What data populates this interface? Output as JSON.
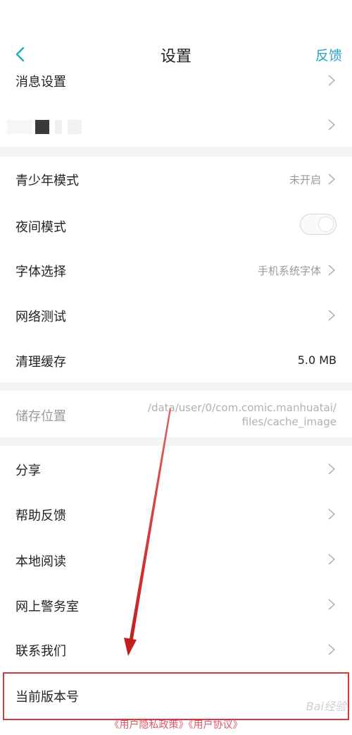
{
  "header": {
    "title": "设置",
    "feedback_label": "反馈"
  },
  "rows": {
    "message_settings": "消息设置",
    "youth_mode": {
      "label": "青少年模式",
      "value": "未开启"
    },
    "night_mode": {
      "label": "夜间模式",
      "on": false
    },
    "font_select": {
      "label": "字体选择",
      "value": "手机系统字体"
    },
    "network_test": "网络测试",
    "clear_cache": {
      "label": "清理缓存",
      "value": "5.0 MB"
    },
    "storage": {
      "label": "储存位置",
      "path_line1": "/data/user/0/com.comic.manhuatai/",
      "path_line2": "files/cache_image"
    },
    "share": "分享",
    "help_feedback": "帮助反馈",
    "local_read": "本地阅读",
    "police": "网上警务室",
    "contact": "联系我们",
    "version": "当前版本号"
  },
  "footer": {
    "links": "《用户隐私政策》《用户协议》"
  },
  "watermark": "Bai经验",
  "colors": {
    "accent": "#2aa5c4",
    "annotation_red": "#d23a3a",
    "link_pink": "#e0556e"
  }
}
